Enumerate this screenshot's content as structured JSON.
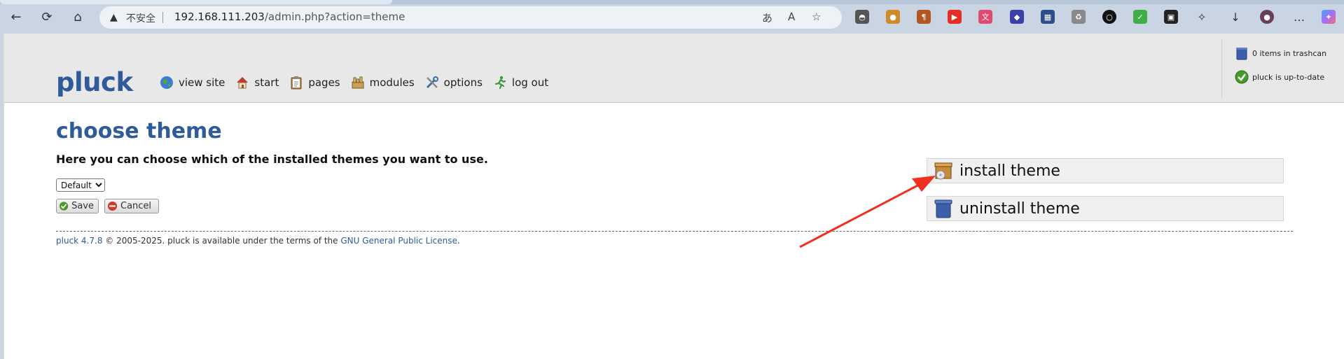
{
  "browser": {
    "insecure_label": "不安全",
    "url_host": "192.168.111.203",
    "url_path": "/admin.php?action=theme"
  },
  "site": {
    "logo": "pluck",
    "nav": [
      {
        "label": "view site",
        "icon": "globe-icon"
      },
      {
        "label": "start",
        "icon": "home-icon"
      },
      {
        "label": "pages",
        "icon": "clipboard-icon"
      },
      {
        "label": "modules",
        "icon": "modules-icon"
      },
      {
        "label": "options",
        "icon": "tools-icon"
      },
      {
        "label": "log out",
        "icon": "runner-icon"
      }
    ],
    "status": {
      "trashcan": "0 items in trashcan",
      "uptodate": "pluck is up-to-date"
    }
  },
  "main": {
    "title": "choose theme",
    "description": "Here you can choose which of the installed themes you want to use.",
    "theme_selected": "Default",
    "save_label": "Save",
    "cancel_label": "Cancel",
    "install_label": "install theme",
    "uninstall_label": "uninstall theme"
  },
  "footer": {
    "version_link": "pluck 4.7.8",
    "text": " © 2005-2025. pluck is available under the terms of the ",
    "license_link": "GNU General Public License",
    "end": "."
  },
  "colors": {
    "brand": "#2f5b9b",
    "annotation_arrow": "#f0301f"
  }
}
